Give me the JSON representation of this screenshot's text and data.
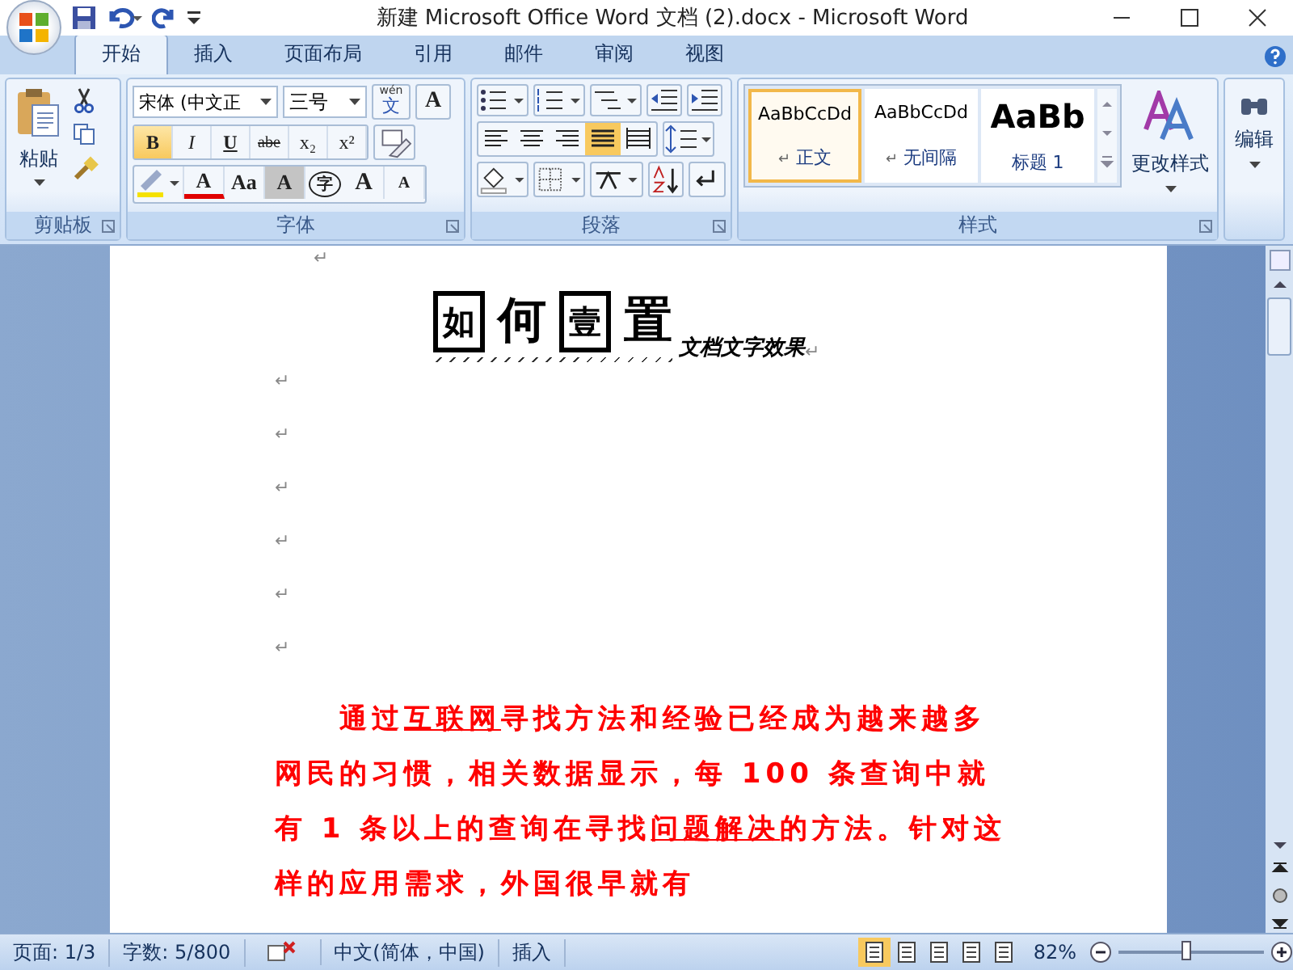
{
  "window": {
    "title": "新建 Microsoft Office Word 文档 (2).docx - Microsoft Word"
  },
  "tabs": [
    {
      "label": "开始",
      "selected": true
    },
    {
      "label": "插入",
      "selected": false
    },
    {
      "label": "页面布局",
      "selected": false
    },
    {
      "label": "引用",
      "selected": false
    },
    {
      "label": "邮件",
      "selected": false
    },
    {
      "label": "审阅",
      "selected": false
    },
    {
      "label": "视图",
      "selected": false
    }
  ],
  "clipboard": {
    "paste": "粘贴",
    "group_label": "剪贴板"
  },
  "font": {
    "name": "宋体 (中文正",
    "size": "三号",
    "phonetic_ruby": "wén",
    "phonetic_base": "文",
    "char_border": "A",
    "group_label": "字体",
    "format_buttons": [
      {
        "label": "B",
        "kind": "bold",
        "selected": true
      },
      {
        "label": "I",
        "kind": "italic",
        "selected": false
      },
      {
        "label": "U",
        "kind": "underline",
        "selected": false
      },
      {
        "label": "abe",
        "kind": "strike",
        "selected": false
      },
      {
        "label": "x₂",
        "kind": "plain",
        "selected": false
      },
      {
        "label": "x²",
        "kind": "plain",
        "selected": false
      }
    ],
    "effect_buttons": [
      {
        "label": "A",
        "kind": "color"
      },
      {
        "label": "Aa",
        "kind": "plain"
      },
      {
        "label": "A",
        "kind": "shaded"
      },
      {
        "label": "字",
        "kind": "enclosed"
      },
      {
        "label": "A",
        "kind": "grow"
      },
      {
        "label": "A",
        "kind": "shrink"
      }
    ]
  },
  "paragraph": {
    "group_label": "段落",
    "alignments": [
      {
        "kind": "left",
        "selected": false
      },
      {
        "kind": "center",
        "selected": false
      },
      {
        "kind": "right",
        "selected": false
      },
      {
        "kind": "justify",
        "selected": true
      },
      {
        "kind": "distributed",
        "selected": false
      }
    ]
  },
  "styles": {
    "group_label": "样式",
    "change_label": "更改样式",
    "items": [
      {
        "sample": "AaBbCcDd",
        "mark": "↵",
        "name": "正文",
        "kind": "normal",
        "selected": true
      },
      {
        "sample": "AaBbCcDd",
        "mark": "↵",
        "name": "无间隔",
        "kind": "normal",
        "selected": false
      },
      {
        "sample": "AaBb",
        "name": "标题 1",
        "kind": "heading",
        "selected": false
      }
    ]
  },
  "editing": {
    "label": "编辑"
  },
  "document": {
    "top_mark": "↵",
    "title": {
      "chars": [
        {
          "text": "如",
          "enclosed": true
        },
        {
          "text": "何",
          "enclosed": false
        },
        {
          "text": "壹",
          "enclosed": true
        },
        {
          "text": "置",
          "enclosed": false
        }
      ],
      "suffix": "文档文字效果",
      "mark": "↵"
    },
    "empty_marks": [
      "↵",
      "↵",
      "↵",
      "↵",
      "↵",
      "↵"
    ],
    "body": [
      {
        "text": "通过",
        "underline": false
      },
      {
        "text": "互联网",
        "underline": true
      },
      {
        "text": "寻找方法和经验已经成为越来越多网民的习惯，相关数据显示，每 100 条查询中就有 1 条以上的查询在寻找",
        "underline": false
      },
      {
        "text": "问题解决",
        "underline": true
      },
      {
        "text": "的方法。针对这样的应用需求，外国很早就有",
        "underline": false
      }
    ]
  },
  "status_bar": {
    "items": [
      "页面: 1/3",
      "字数: 5/800"
    ],
    "language": "中文(简体，中国)",
    "mode": "插入",
    "views": [
      {
        "selected": true
      },
      {
        "selected": false
      },
      {
        "selected": false
      },
      {
        "selected": false
      },
      {
        "selected": false
      }
    ],
    "zoom": "82%",
    "zoom_level": {
      "level": 0.47
    }
  }
}
